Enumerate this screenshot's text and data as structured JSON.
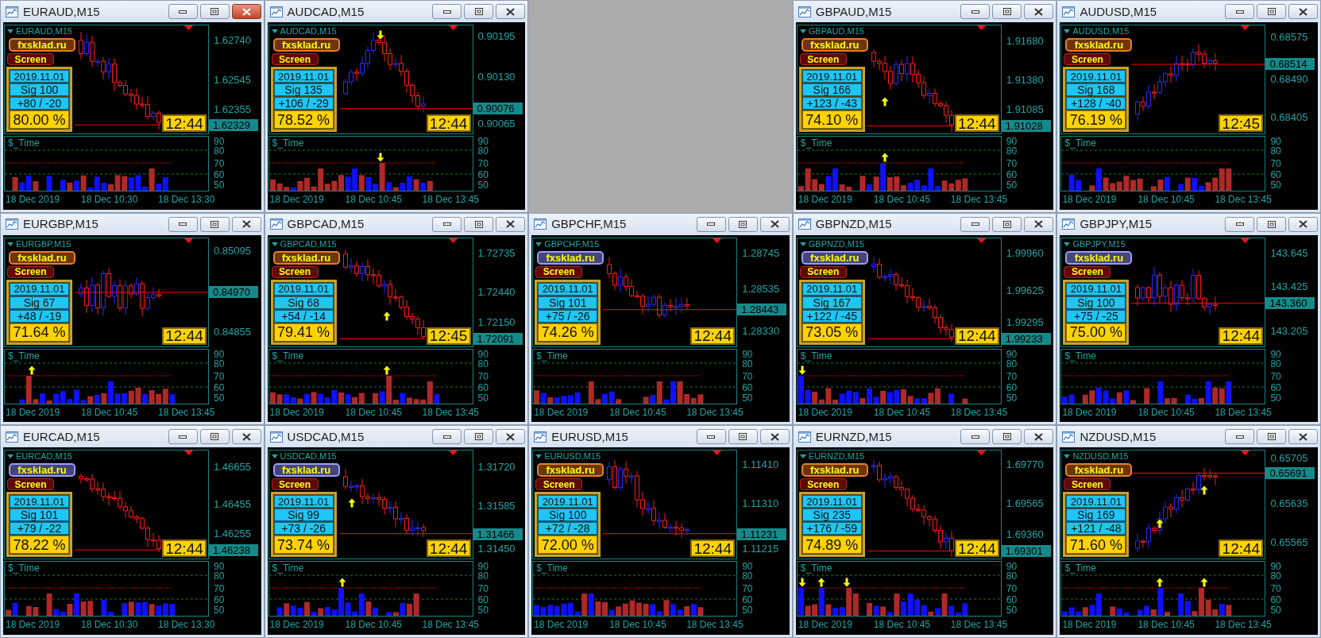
{
  "windows": [
    {
      "title": "EURAUD,M15",
      "active": true,
      "chart": {
        "label": "EURAUD,M15",
        "site_button": {
          "label": "fxsklad.ru",
          "color": "#6e3509"
        },
        "screen_button": "Screen",
        "info": {
          "date": "2019.11.01",
          "signals": "Sig 100",
          "result": "+80 / -20",
          "percent": "80.00 %"
        },
        "clock": "12:44",
        "price_ticks": [
          "1.62740",
          "1.62545",
          "1.62355"
        ],
        "bid": "1.62329"
      },
      "indicator": {
        "label": "$_Time",
        "ticks": [
          "90",
          "80",
          "70",
          "60",
          "50"
        ]
      },
      "time_ticks": [
        "18 Dec 2019",
        "18 Dec 10:30",
        "18 Dec 13:30"
      ]
    },
    {
      "title": "AUDCAD,M15",
      "active": false,
      "chart": {
        "label": "AUDCAD,M15",
        "site_button": {
          "label": "fxsklad.ru",
          "color": "#6e3509"
        },
        "screen_button": "Screen",
        "info": {
          "date": "2019.11.01",
          "signals": "Sig 135",
          "result": "+106 / -29",
          "percent": "78.52 %"
        },
        "clock": "12:44",
        "price_ticks": [
          "0.90195",
          "0.90130",
          "0.90065"
        ],
        "bid": "0.90076"
      },
      "indicator": {
        "label": "$_Time",
        "ticks": [
          "90",
          "80",
          "70",
          "60",
          "50"
        ]
      },
      "time_ticks": [
        "18 Dec 2019",
        "18 Dec 10:45",
        "18 Dec 13:45"
      ]
    },
    {
      "title": "GBPAUD,M15",
      "active": false,
      "chart": {
        "label": "GBPAUD,M15",
        "site_button": {
          "label": "fxsklad.ru",
          "color": "#6e3509"
        },
        "screen_button": "Screen",
        "info": {
          "date": "2019.11.01",
          "signals": "Sig 166",
          "result": "+123 / -43",
          "percent": "74.10 %"
        },
        "clock": "12:44",
        "price_ticks": [
          "1.91680",
          "1.91380",
          "1.91085"
        ],
        "bid": "1.91028"
      },
      "indicator": {
        "label": "$_Time",
        "ticks": [
          "90",
          "80",
          "70",
          "60",
          "50"
        ]
      },
      "time_ticks": [
        "18 Dec 2019",
        "18 Dec 10:45",
        "18 Dec 13:45"
      ]
    },
    {
      "title": "AUDUSD,M15",
      "active": false,
      "chart": {
        "label": "AUDUSD,M15",
        "site_button": {
          "label": "fxsklad.ru",
          "color": "#6e3509"
        },
        "screen_button": "Screen",
        "info": {
          "date": "2019.11.01",
          "signals": "Sig 168",
          "result": "+128 / -40",
          "percent": "76.19 %"
        },
        "clock": "12:45",
        "price_ticks": [
          "0.68575",
          "0.68490",
          "0.68405"
        ],
        "bid": "0.68514"
      },
      "indicator": {
        "label": "$_Time",
        "ticks": [
          "90",
          "80",
          "70",
          "60",
          "50"
        ]
      },
      "time_ticks": [
        "18 Dec 2019",
        "18 Dec 10:45",
        "18 Dec 13:45"
      ]
    },
    {
      "title": "EURGBP,M15",
      "active": false,
      "chart": {
        "label": "EURGBP,M15",
        "site_button": {
          "label": "fxsklad.ru",
          "color": "#6e3509"
        },
        "screen_button": "Screen",
        "info": {
          "date": "2019.11.01",
          "signals": "Sig 67",
          "result": "+48 / -19",
          "percent": "71.64 %"
        },
        "clock": "12:44",
        "price_ticks": [
          "0.85095",
          "0.84855"
        ],
        "bid": "0.84970"
      },
      "indicator": {
        "label": "$_Time",
        "ticks": [
          "90",
          "80",
          "70",
          "60",
          "50"
        ]
      },
      "time_ticks": [
        "18 Dec 2019",
        "18 Dec 10:45",
        "18 Dec 13:45"
      ]
    },
    {
      "title": "GBPCAD,M15",
      "active": false,
      "chart": {
        "label": "GBPCAD,M15",
        "site_button": {
          "label": "fxsklad.ru",
          "color": "#6e3509"
        },
        "screen_button": "Screen",
        "info": {
          "date": "2019.11.01",
          "signals": "Sig 68",
          "result": "+54 / -14",
          "percent": "79.41 %"
        },
        "clock": "12:45",
        "price_ticks": [
          "1.72735",
          "1.72440",
          "1.72150"
        ],
        "bid": "1.72091"
      },
      "indicator": {
        "label": "$_Time",
        "ticks": [
          "90",
          "80",
          "70",
          "60",
          "50"
        ]
      },
      "time_ticks": [
        "18 Dec 2019",
        "18 Dec 10:45",
        "18 Dec 13:45"
      ]
    },
    {
      "title": "GBPCHF,M15",
      "active": false,
      "chart": {
        "label": "GBPCHF,M15",
        "site_button": {
          "label": "fxsklad.ru",
          "color": "#45457a"
        },
        "screen_button": "Screen",
        "info": {
          "date": "2019.11.01",
          "signals": "Sig 101",
          "result": "+75 / -26",
          "percent": "74.26 %"
        },
        "clock": "12:44",
        "price_ticks": [
          "1.28745",
          "1.28535",
          "1.28330"
        ],
        "bid": "1.28443"
      },
      "indicator": {
        "label": "$_Time",
        "ticks": [
          "90",
          "80",
          "70",
          "60",
          "50"
        ]
      },
      "time_ticks": [
        "18 Dec 2019",
        "18 Dec 10:45",
        "18 Dec 13:45"
      ]
    },
    {
      "title": "GBPNZD,M15",
      "active": false,
      "chart": {
        "label": "GBPNZD,M15",
        "site_button": {
          "label": "fxsklad.ru",
          "color": "#45457a"
        },
        "screen_button": "Screen",
        "info": {
          "date": "2019.11.01",
          "signals": "Sig 167",
          "result": "+122 / -45",
          "percent": "73.05 %"
        },
        "clock": "12:44",
        "price_ticks": [
          "1.99960",
          "1.99625",
          "1.99295"
        ],
        "bid": "1.99233"
      },
      "indicator": {
        "label": "$_Time",
        "ticks": [
          "90",
          "80",
          "70",
          "60",
          "50"
        ]
      },
      "time_ticks": [
        "18 Dec 2019",
        "18 Dec 10:45",
        "18 Dec 13:45"
      ]
    },
    {
      "title": "GBPJPY,M15",
      "active": false,
      "chart": {
        "label": "GBPJPY,M15",
        "site_button": {
          "label": "fxsklad.ru",
          "color": "#45457a"
        },
        "screen_button": "Screen",
        "info": {
          "date": "2019.11.01",
          "signals": "Sig 100",
          "result": "+75 / -25",
          "percent": "75.00 %"
        },
        "clock": "12:44",
        "price_ticks": [
          "143.645",
          "143.425",
          "143.205"
        ],
        "bid": "143.360"
      },
      "indicator": {
        "label": "$_Time",
        "ticks": [
          "90",
          "80",
          "70",
          "60",
          "50"
        ]
      },
      "time_ticks": [
        "18 Dec 2019",
        "18 Dec 10:45",
        "18 Dec 13:45"
      ]
    },
    {
      "title": "EURCAD,M15",
      "active": false,
      "chart": {
        "label": "EURCAD,M15",
        "site_button": {
          "label": "fxsklad.ru",
          "color": "#45457a"
        },
        "screen_button": "Screen",
        "info": {
          "date": "2019.11.01",
          "signals": "Sig 101",
          "result": "+79 / -22",
          "percent": "78.22 %"
        },
        "clock": "12:44",
        "price_ticks": [
          "1.46655",
          "1.46455",
          "1.46255"
        ],
        "bid": "1.46238"
      },
      "indicator": {
        "label": "$_Time",
        "ticks": [
          "90",
          "80",
          "70",
          "60",
          "50"
        ]
      },
      "time_ticks": [
        "18 Dec 2019",
        "18 Dec 10:30",
        "18 Dec 13:30"
      ]
    },
    {
      "title": "USDCAD,M15",
      "active": false,
      "chart": {
        "label": "USDCAD,M15",
        "site_button": {
          "label": "fxsklad.ru",
          "color": "#45457a"
        },
        "screen_button": "Screen",
        "info": {
          "date": "2019.11.01",
          "signals": "Sig 99",
          "result": "+73 / -26",
          "percent": "73.74 %"
        },
        "clock": "12:44",
        "price_ticks": [
          "1.31720",
          "1.31585",
          "1.31450"
        ],
        "bid": "1.31466"
      },
      "indicator": {
        "label": "$_Time",
        "ticks": [
          "90",
          "80",
          "70",
          "60",
          "50"
        ]
      },
      "time_ticks": [
        "18 Dec 2019",
        "18 Dec 10:45",
        "18 Dec 13:45"
      ]
    },
    {
      "title": "EURUSD,M15",
      "active": false,
      "chart": {
        "label": "EURUSD,M15",
        "site_button": {
          "label": "fxsklad.ru",
          "color": "#6e3509"
        },
        "screen_button": "Screen",
        "info": {
          "date": "2019.11.01",
          "signals": "Sig 100",
          "result": "+72 / -28",
          "percent": "72.00 %"
        },
        "clock": "12:44",
        "price_ticks": [
          "1.11410",
          "1.11310",
          "1.11215"
        ],
        "bid": "1.11231"
      },
      "indicator": {
        "label": "$_Time",
        "ticks": [
          "90",
          "80",
          "70",
          "60",
          "50"
        ]
      },
      "time_ticks": [
        "18 Dec 2019",
        "18 Dec 10:45",
        "18 Dec 13:45"
      ]
    },
    {
      "title": "EURNZD,M15",
      "active": false,
      "chart": {
        "label": "EURNZD,M15",
        "site_button": {
          "label": "fxsklad.ru",
          "color": "#6e3509"
        },
        "screen_button": "Screen",
        "info": {
          "date": "2019.11.01",
          "signals": "Sig 235",
          "result": "+176 / -59",
          "percent": "74.89 %"
        },
        "clock": "12:44",
        "price_ticks": [
          "1.69770",
          "1.69565",
          "1.69360"
        ],
        "bid": "1.69301"
      },
      "indicator": {
        "label": "$_Time",
        "ticks": [
          "90",
          "80",
          "70",
          "60",
          "50"
        ]
      },
      "time_ticks": [
        "18 Dec 2019",
        "18 Dec 10:45",
        "18 Dec 13:45"
      ]
    },
    {
      "title": "NZDUSD,M15",
      "active": false,
      "chart": {
        "label": "NZDUSD,M15",
        "site_button": {
          "label": "fxsklad.ru",
          "color": "#6e3509"
        },
        "screen_button": "Screen",
        "info": {
          "date": "2019.11.01",
          "signals": "Sig 169",
          "result": "+121 / -48",
          "percent": "71.60 %"
        },
        "clock": "12:44",
        "price_ticks": [
          "0.65705",
          "0.65635",
          "0.65565"
        ],
        "bid": "0.65691"
      },
      "indicator": {
        "label": "$_Time",
        "ticks": [
          "90",
          "80",
          "70",
          "60",
          "50"
        ]
      },
      "time_ticks": [
        "18 Dec 2019",
        "18 Dec 10:45",
        "18 Dec 13:45"
      ]
    }
  ]
}
